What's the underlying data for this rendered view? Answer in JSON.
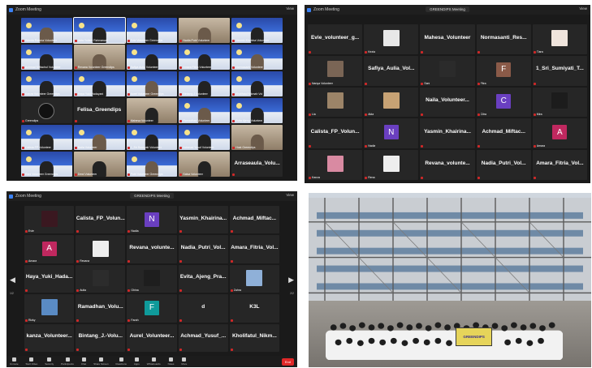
{
  "panel1": {
    "window_title": "Zoom Meeting",
    "view_label": "View",
    "tiles": [
      {
        "kind": "bg",
        "name": "Wanda Rahma Volunteer"
      },
      {
        "kind": "bg",
        "name": "Julia Yuliani Rahmawati",
        "highlight": true
      },
      {
        "kind": "bg",
        "name": "Evie Volunteer Greendips"
      },
      {
        "kind": "photo",
        "name": "Nadia Putri Volunteer"
      },
      {
        "kind": "bg",
        "name": "Yasmin Khairina Volunteer"
      },
      {
        "kind": "bg",
        "name": "Achmad Miftachul Volunteer"
      },
      {
        "kind": "photo",
        "name": "Revana Volunteer Greendips"
      },
      {
        "kind": "bg",
        "name": "Safiya Aulia Volunteer"
      },
      {
        "kind": "bg",
        "name": "Amara Fitria Volunteer"
      },
      {
        "kind": "bg",
        "name": "Normasanti Volunteer"
      },
      {
        "kind": "bg",
        "name": "Kanza Volunteer Greendips"
      },
      {
        "kind": "bg",
        "name": "Haya Yuki Hadayani"
      },
      {
        "kind": "bg",
        "name": "Aurel Volunteer Greendips"
      },
      {
        "kind": "bg",
        "name": "Bintang J Volunteer"
      },
      {
        "kind": "bg",
        "name": "Kholifatul Nikmah Vol"
      },
      {
        "kind": "logo",
        "name": "Greendips"
      },
      {
        "kind": "text",
        "label": "Felisa_Greendips"
      },
      {
        "kind": "photo",
        "name": "Mahesa Volunteer"
      },
      {
        "kind": "bg",
        "name": "Ramadhan Volunteer"
      },
      {
        "kind": "bg",
        "name": "Evita Ajeng Volunteer"
      },
      {
        "kind": "bg",
        "name": "Calista FP Volunteer"
      },
      {
        "kind": "bg",
        "name": "Naila Volunteer"
      },
      {
        "kind": "bg",
        "name": "1_Sri Sumiyati Volunteer"
      },
      {
        "kind": "bg",
        "name": "Achmad Yusuf Volunteer"
      },
      {
        "kind": "photo",
        "name": "Host Greendips"
      },
      {
        "kind": "bg",
        "name": "Rani Volunteer Greendips"
      },
      {
        "kind": "photo",
        "name": "Dewi Volunteer"
      },
      {
        "kind": "bg",
        "name": "Putri Volunteer Greendips"
      },
      {
        "kind": "photo",
        "name": "Salsa Volunteer"
      },
      {
        "kind": "text",
        "label": "Arraseaula_Volu..."
      }
    ]
  },
  "panel2": {
    "window_title": "Zoom Meeting",
    "tag_label": "GREENDIPS Meeting",
    "view_label": "View",
    "tiles": [
      {
        "kind": "text",
        "label": "Evie_volunteer_g..."
      },
      {
        "kind": "avatar",
        "color": "#e8e8e8",
        "name": "Kezia"
      },
      {
        "kind": "text",
        "label": "Mahesa_Volunteer"
      },
      {
        "kind": "text",
        "label": "Normasanti_Res..."
      },
      {
        "kind": "avatar",
        "color": "#efe4dc",
        "name": "Tiara"
      },
      {
        "kind": "avatar",
        "color": "#7a6555",
        "name": "Nanya Volunteer"
      },
      {
        "kind": "text",
        "label": "Safiya_Aulia_Vol..."
      },
      {
        "kind": "avatar",
        "color": "#2b2b2b",
        "name": "Sani"
      },
      {
        "kind": "letter",
        "letter": "F",
        "color": "#8a5a48",
        "name": "Fitra"
      },
      {
        "kind": "text",
        "label": "1_Sri_Sumiyati_T..."
      },
      {
        "kind": "avatar",
        "color": "#9c8468",
        "name": "Lia"
      },
      {
        "kind": "avatar",
        "color": "#c7a274",
        "name": "Alda"
      },
      {
        "kind": "text",
        "label": "Naila_Volunteer..."
      },
      {
        "kind": "letter",
        "letter": "C",
        "color": "#6a3fc0",
        "name": "Citra"
      },
      {
        "kind": "avatar",
        "color": "#1c1c1c",
        "name": "Mira"
      },
      {
        "kind": "text",
        "label": "Calista_FP_Volun..."
      },
      {
        "kind": "letter",
        "letter": "N",
        "color": "#6a3fc0",
        "name": "Nadia"
      },
      {
        "kind": "text",
        "label": "Yasmin_Khairina..."
      },
      {
        "kind": "text",
        "label": "Achmad_Miftac..."
      },
      {
        "kind": "letter",
        "letter": "A",
        "color": "#c0285f",
        "name": "Amara"
      },
      {
        "kind": "avatar",
        "color": "#d98aa2",
        "name": "Kanza"
      },
      {
        "kind": "avatar",
        "color": "#eeeeee",
        "name": "Rena"
      },
      {
        "kind": "text",
        "label": "Revana_volunte..."
      },
      {
        "kind": "text",
        "label": "Nadia_Putri_Vol..."
      },
      {
        "kind": "text",
        "label": "Amara_Fitria_Vol..."
      }
    ]
  },
  "panel3": {
    "window_title": "Zoom Meeting",
    "tag_label": "GREENDIPS Meeting",
    "view_label": "View",
    "page_left": "1/2",
    "page_right": "2/2",
    "tiles": [
      {
        "kind": "avatar",
        "color": "#3a1820",
        "name": "Evie"
      },
      {
        "kind": "text",
        "label": "Calista_FP_Volun..."
      },
      {
        "kind": "letter",
        "letter": "N",
        "color": "#6a3fc0",
        "name": "Nadia"
      },
      {
        "kind": "text",
        "label": "Yasmin_Khairina..."
      },
      {
        "kind": "text",
        "label": "Achmad_Miftac..."
      },
      {
        "kind": "letter",
        "letter": "A",
        "color": "#c0285f",
        "name": "Amara"
      },
      {
        "kind": "avatar",
        "color": "#eeeeee",
        "name": "Revana"
      },
      {
        "kind": "text",
        "label": "Revana_volunte..."
      },
      {
        "kind": "text",
        "label": "Nadia_Putri_Vol..."
      },
      {
        "kind": "text",
        "label": "Amara_Fitria_Vol..."
      },
      {
        "kind": "text",
        "label": "Haya_Yuki_Hada..."
      },
      {
        "kind": "avatar",
        "color": "#2c2c2c",
        "name": "Aulia"
      },
      {
        "kind": "avatar",
        "color": "#1e1e1e",
        "name": "Ghina"
      },
      {
        "kind": "text",
        "label": "Evita_Ajeng_Pra..."
      },
      {
        "kind": "avatar",
        "color": "#8fb0d8",
        "name": "Zahra"
      },
      {
        "kind": "avatar",
        "color": "#5a8bc4",
        "name": "Rizky"
      },
      {
        "kind": "text",
        "label": "Ramadhan_Volu..."
      },
      {
        "kind": "letter",
        "letter": "F",
        "color": "#0f9a9a",
        "name": "Farah"
      },
      {
        "kind": "text",
        "label": "d"
      },
      {
        "kind": "text",
        "label": "K3L"
      },
      {
        "kind": "text",
        "label": "kanza_Volunteer..."
      },
      {
        "kind": "text",
        "label": "Bintang_J.-Volu..."
      },
      {
        "kind": "text",
        "label": "Aurel_Volunteer..."
      },
      {
        "kind": "text",
        "label": "Achmad_Yusuf_..."
      },
      {
        "kind": "text",
        "label": "Kholifatul_Nikm..."
      }
    ],
    "toolbar": {
      "items": [
        "Unmute",
        "Start Video",
        "Security",
        "Participants",
        "Chat",
        "Share Screen",
        "Reactions",
        "Apps",
        "Whiteboards",
        "Notes",
        "More"
      ],
      "end_label": "End"
    }
  },
  "photo": {
    "banner_text": "GREENDIPS"
  }
}
